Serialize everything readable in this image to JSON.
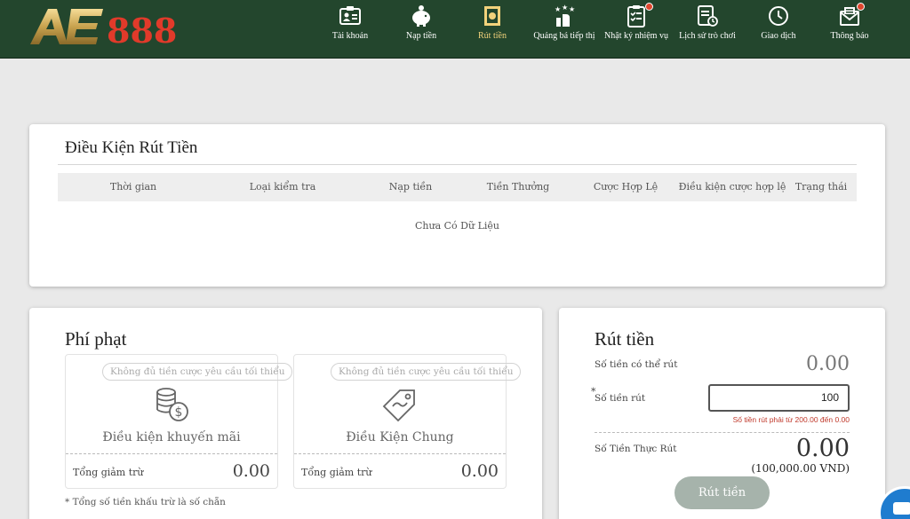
{
  "brand": {
    "logo_text": "AE888"
  },
  "nav": [
    {
      "label": "Tài khoản",
      "icon": "account-card-icon"
    },
    {
      "label": "Nạp tiền",
      "icon": "piggy-bank-icon"
    },
    {
      "label": "Rút tiền",
      "icon": "withdraw-icon",
      "active": true
    },
    {
      "label": "Quảng bá tiếp thị",
      "icon": "promotion-icon"
    },
    {
      "label": "Nhật ký nhiệm vụ",
      "icon": "task-log-icon",
      "badge": true
    },
    {
      "label": "Lịch sử trò chơi",
      "icon": "game-history-icon"
    },
    {
      "label": "Giao dịch",
      "icon": "transaction-clock-icon"
    },
    {
      "label": "Thông báo",
      "icon": "mail-icon",
      "badge": true
    }
  ],
  "conditions": {
    "title": "Điều Kiện Rút Tiền",
    "columns": [
      "Thời gian",
      "Loại kiểm tra",
      "Nạp tiền",
      "Tiền Thưởng",
      "Cược Hợp Lệ",
      "Điều kiện cược hợp lệ",
      "Trạng thái"
    ],
    "empty_text": "Chưa Có Dữ Liệu"
  },
  "penalty": {
    "title": "Phí phạt",
    "boxes": [
      {
        "pill": "Không đủ tiền cược yêu cầu tối thiểu",
        "name": "Điều kiện khuyến mãi",
        "sum_label": "Tổng giảm trừ",
        "sum_value": "0.00",
        "icon": "coins-dollar-icon"
      },
      {
        "pill": "Không đủ tiền cược yêu cầu tối thiểu",
        "name": "Điều Kiện Chung",
        "sum_label": "Tổng giảm trừ",
        "sum_value": "0.00",
        "icon": "price-tag-icon"
      }
    ],
    "footnote": "* Tổng số tiền khấu trừ là số chẵn"
  },
  "withdraw": {
    "title": "Rút tiền",
    "available_label": "Số tiền có thể rút",
    "available_value": "0.00",
    "amount_star": "*",
    "amount_label": "Số tiền rút",
    "amount_value": "100",
    "error_text": "Số tiền rút phải từ 200.00 đến 0.00",
    "actual_label": "Số Tiền Thực Rút",
    "actual_value": "0.00",
    "actual_vnd": "(100,000.00 VND)",
    "button_label": "Rút tiền"
  },
  "colors": {
    "header": "#23462d",
    "active_nav": "#f2d27b",
    "badge": "#e0462d",
    "error": "#c0392b",
    "button": "#a6b3ab",
    "chat": "#1f7ccf"
  }
}
